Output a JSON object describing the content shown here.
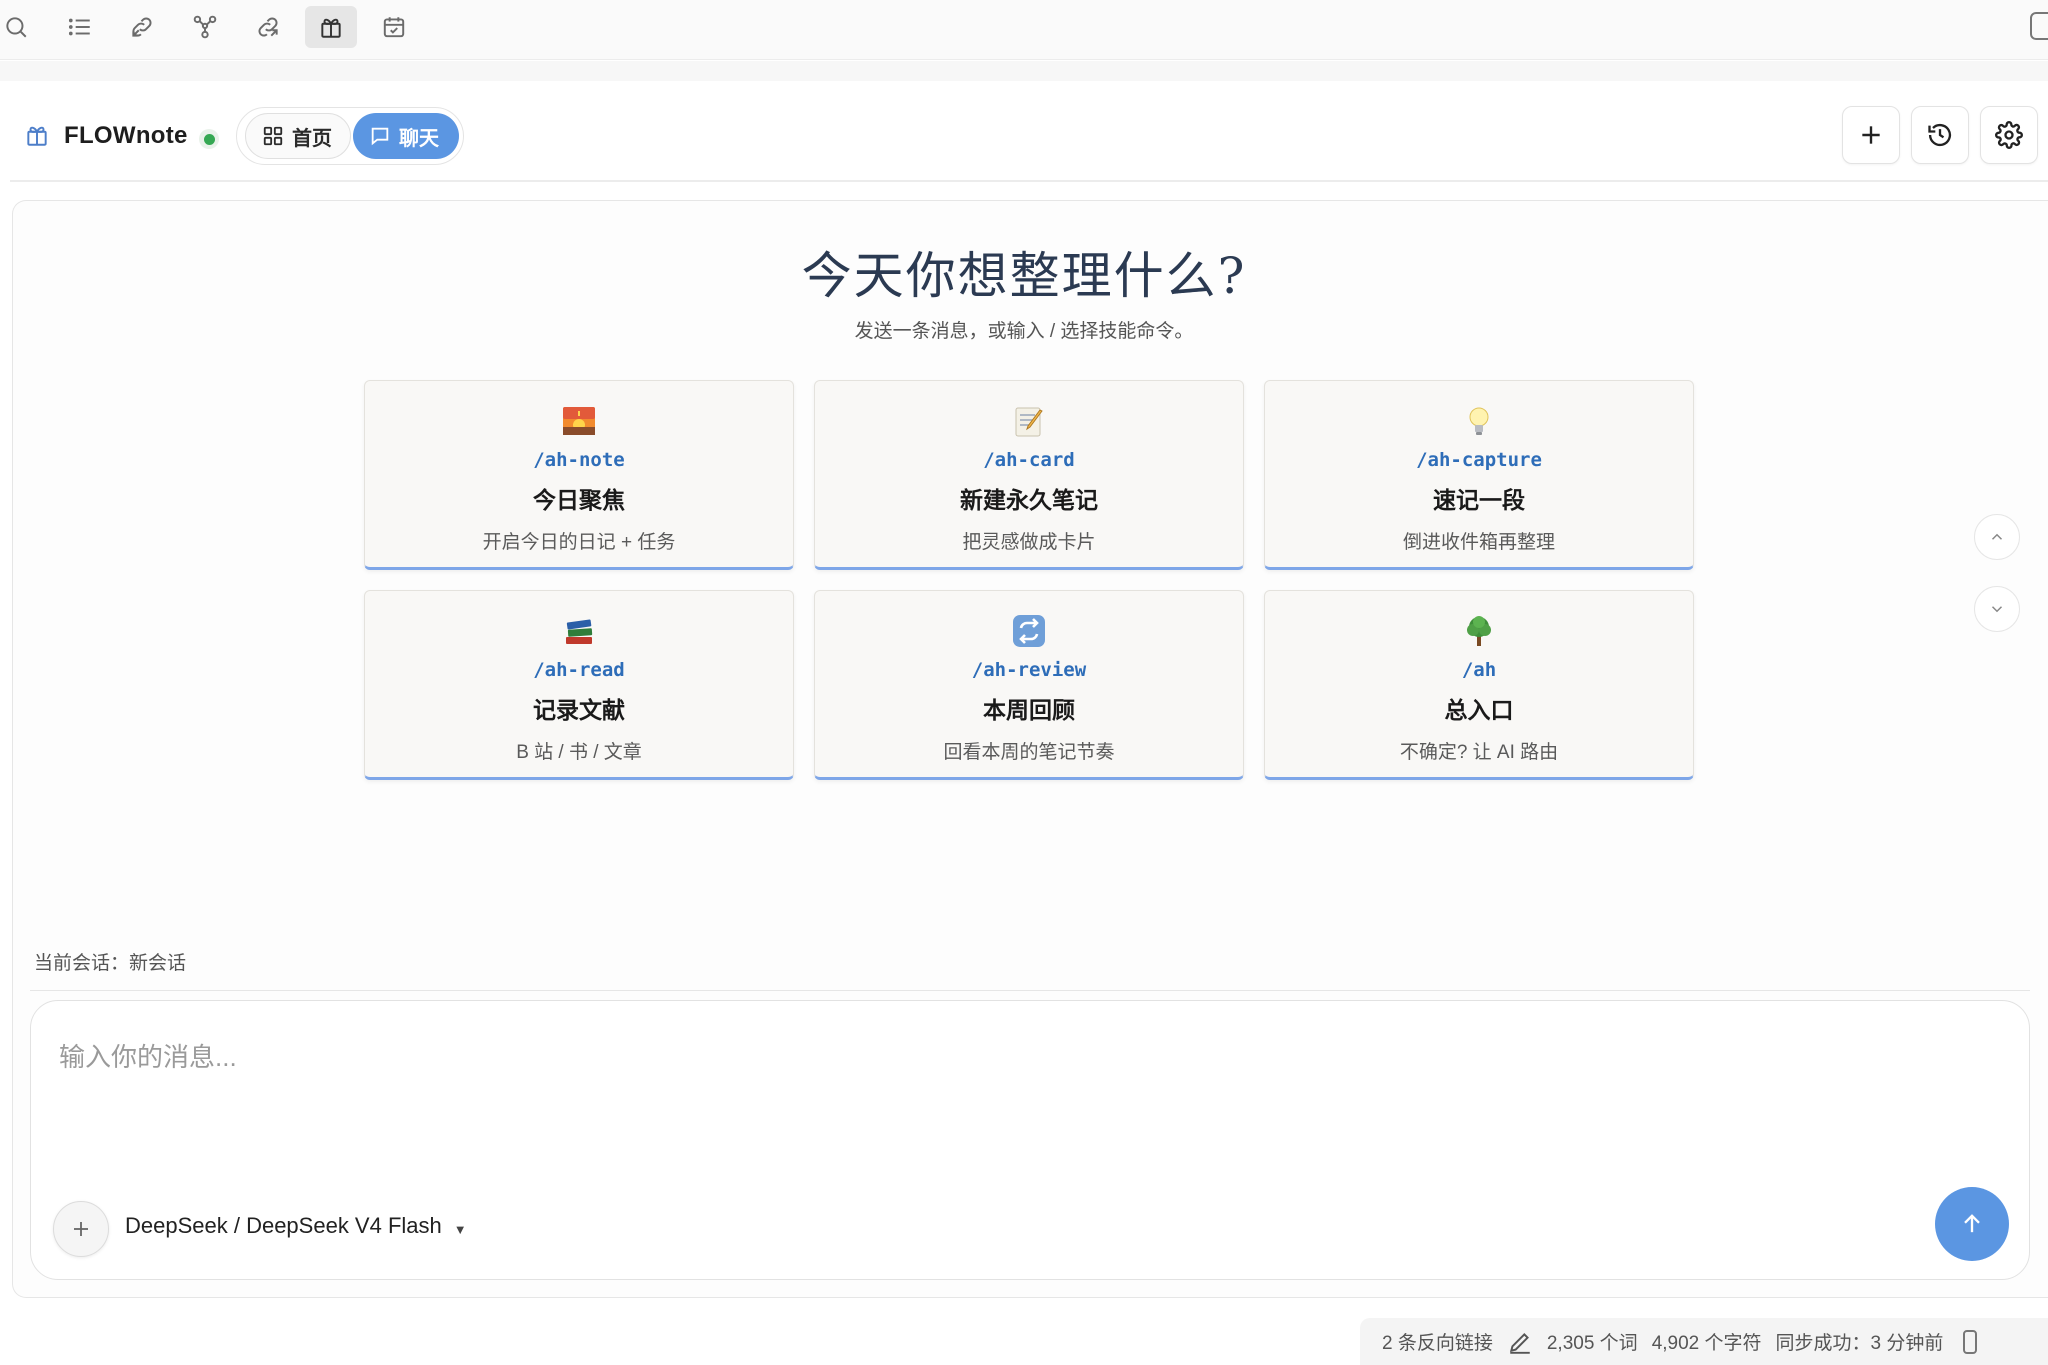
{
  "ribbon": {
    "icons": [
      "search-icon",
      "outline-list-icon",
      "backlink-icon",
      "graph-icon",
      "outgoing-link-icon",
      "flownote-icon",
      "calendar-icon"
    ],
    "active": "flownote-icon"
  },
  "header": {
    "app_name": "FLOWnote",
    "status": "connected",
    "tabs": [
      {
        "label": "首页",
        "icon": "grid-icon",
        "active": false
      },
      {
        "label": "聊天",
        "icon": "chat-bubble-icon",
        "active": true
      }
    ],
    "actions": [
      "new-chat-icon",
      "history-icon",
      "settings-icon"
    ]
  },
  "hero": {
    "title": "今天你想整理什么?",
    "subtitle": "发送一条消息，或输入 / 选择技能命令。"
  },
  "skills": [
    {
      "emoji": "sunrise",
      "command": "/ah-note",
      "title": "今日聚焦",
      "description": "开启今日的日记 + 任务"
    },
    {
      "emoji": "memo",
      "command": "/ah-card",
      "title": "新建永久笔记",
      "description": "把灵感做成卡片"
    },
    {
      "emoji": "light-bulb",
      "command": "/ah-capture",
      "title": "速记一段",
      "description": "倒进收件箱再整理"
    },
    {
      "emoji": "books",
      "command": "/ah-read",
      "title": "记录文献",
      "description": "B 站 / 书 / 文章"
    },
    {
      "emoji": "repeat",
      "command": "/ah-review",
      "title": "本周回顾",
      "description": "回看本周的笔记节奏"
    },
    {
      "emoji": "tree",
      "command": "/ah",
      "title": "总入口",
      "description": "不确定? 让 AI 路由"
    }
  ],
  "session": {
    "label": "当前会话：新会话"
  },
  "composer": {
    "placeholder": "输入你的消息...",
    "value": "",
    "model": "DeepSeek / DeepSeek V4 Flash"
  },
  "statusbar": {
    "backlinks": "2 条反向链接",
    "words": "2,305 个词",
    "chars": "4,902 个字符",
    "sync": "同步成功：3 分钟前"
  },
  "colors": {
    "accent": "#5b96e2",
    "command_text": "#2e6db8",
    "status_green": "#35a853",
    "card_bg": "#f9f8f6"
  }
}
